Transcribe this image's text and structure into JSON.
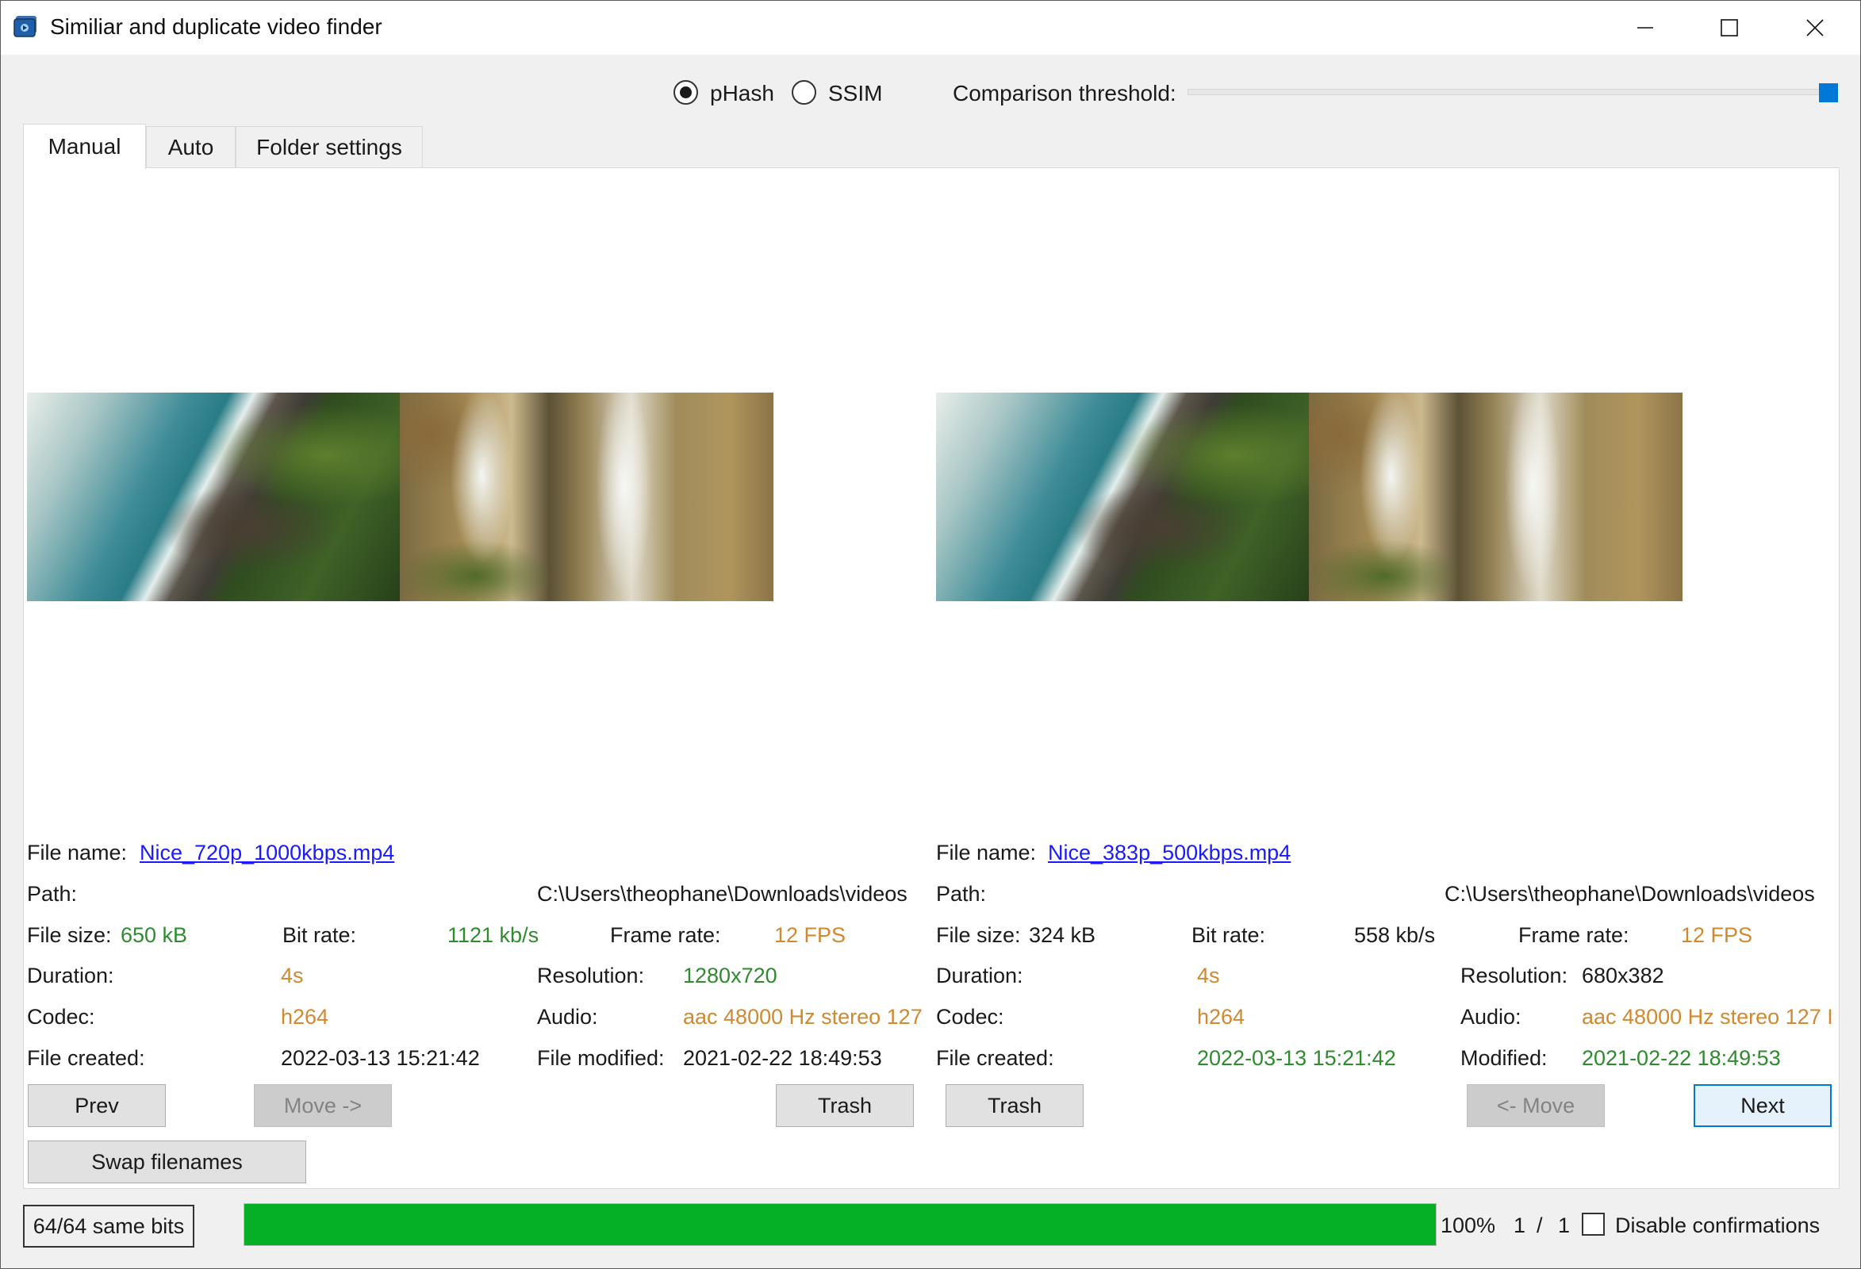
{
  "window": {
    "title": "Similiar and duplicate video finder",
    "app_icon": "video-camera-icon",
    "controls": [
      "minimize-icon",
      "maximize-icon",
      "close-icon"
    ]
  },
  "options": {
    "algorithms": [
      {
        "label": "pHash",
        "selected": true
      },
      {
        "label": "SSIM",
        "selected": false
      }
    ],
    "threshold_label": "Comparison threshold:",
    "threshold_value": 1.0,
    "accent_color": "#0078d7"
  },
  "tabs": [
    {
      "label": "Manual",
      "active": true
    },
    {
      "label": "Auto",
      "active": false
    },
    {
      "label": "Folder settings",
      "active": false
    }
  ],
  "left": {
    "file_name_label": "File name:",
    "file_name": "Nice_720p_1000kbps.mp4",
    "path_label": "Path:",
    "path": "C:\\Users\\theophane\\Downloads\\videos",
    "file_size_label": "File size:",
    "file_size": "650 kB",
    "bit_rate_label": "Bit rate:",
    "bit_rate": "1121 kb/s",
    "frame_rate_label": "Frame rate:",
    "frame_rate": "12 FPS",
    "duration_label": "Duration:",
    "duration": "4s",
    "resolution_label": "Resolution:",
    "resolution": "1280x720",
    "codec_label": "Codec:",
    "codec": "h264",
    "audio_label": "Audio:",
    "audio": "aac 48000 Hz stereo 127",
    "created_label": "File created:",
    "created": "2022-03-13 15:21:42",
    "modified_label": "File modified:",
    "modified": "2021-02-22 18:49:53"
  },
  "right": {
    "file_name_label": "File name:",
    "file_name": "Nice_383p_500kbps.mp4",
    "path_label": "Path:",
    "path": "C:\\Users\\theophane\\Downloads\\videos",
    "file_size_label": "File size:",
    "file_size": "324 kB",
    "bit_rate_label": "Bit rate:",
    "bit_rate": "558 kb/s",
    "frame_rate_label": "Frame rate:",
    "frame_rate": "12 FPS",
    "duration_label": "Duration:",
    "duration": "4s",
    "resolution_label": "Resolution:",
    "resolution": "680x382",
    "codec_label": "Codec:",
    "codec": "h264",
    "audio_label": "Audio:",
    "audio": "aac 48000 Hz stereo 127 I",
    "created_label": "File created:",
    "created": "2022-03-13 15:21:42",
    "modified_label": "Modified:",
    "modified": "2021-02-22 18:49:53"
  },
  "buttons": {
    "prev": "Prev",
    "move_right": "Move ->",
    "trash_left": "Trash",
    "trash_right": "Trash",
    "move_left": "<- Move",
    "next": "Next",
    "swap": "Swap filenames"
  },
  "status": {
    "same_bits": "64/64 same bits",
    "progress_percent": 100,
    "progress_text": "100%",
    "current": "1",
    "separator": "/",
    "total": "1",
    "disable_confirmations_label": "Disable confirmations",
    "disable_confirmations_checked": false,
    "progress_color": "#06b025"
  },
  "colors": {
    "link": "#1a1aff",
    "better": "#2e8b2e",
    "equal": "#d2882e"
  }
}
